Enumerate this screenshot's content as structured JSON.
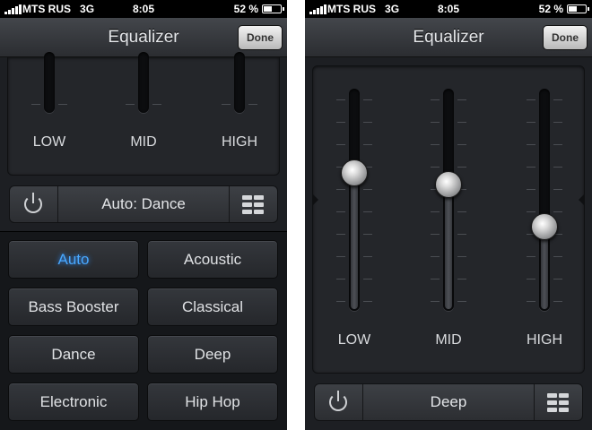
{
  "status_bar": {
    "carrier": "MTS RUS",
    "network": "3G",
    "time": "8:05",
    "battery_percent": "52 %",
    "battery_level": 0.52
  },
  "left_screen": {
    "title": "Equalizer",
    "done_label": "Done",
    "bands": [
      {
        "label": "LOW"
      },
      {
        "label": "MID"
      },
      {
        "label": "HIGH"
      }
    ],
    "current_preset": "Auto: Dance",
    "presets": [
      {
        "label": "Auto",
        "active": true
      },
      {
        "label": "Acoustic",
        "active": false
      },
      {
        "label": "Bass Booster",
        "active": false
      },
      {
        "label": "Classical",
        "active": false
      },
      {
        "label": "Dance",
        "active": false
      },
      {
        "label": "Deep",
        "active": false
      },
      {
        "label": "Electronic",
        "active": false
      },
      {
        "label": "Hip Hop",
        "active": false
      }
    ]
  },
  "right_screen": {
    "title": "Equalizer",
    "done_label": "Done",
    "bands": [
      {
        "label": "LOW",
        "level": 0.62
      },
      {
        "label": "MID",
        "level": 0.57
      },
      {
        "label": "HIGH",
        "level": 0.38
      }
    ],
    "current_preset": "Deep"
  },
  "colors": {
    "background": "#1d1f23",
    "active_preset": "#48a8ff",
    "text": "#e0e2e5"
  },
  "icons": {
    "power": "power-icon",
    "presets": "grid-icon"
  }
}
